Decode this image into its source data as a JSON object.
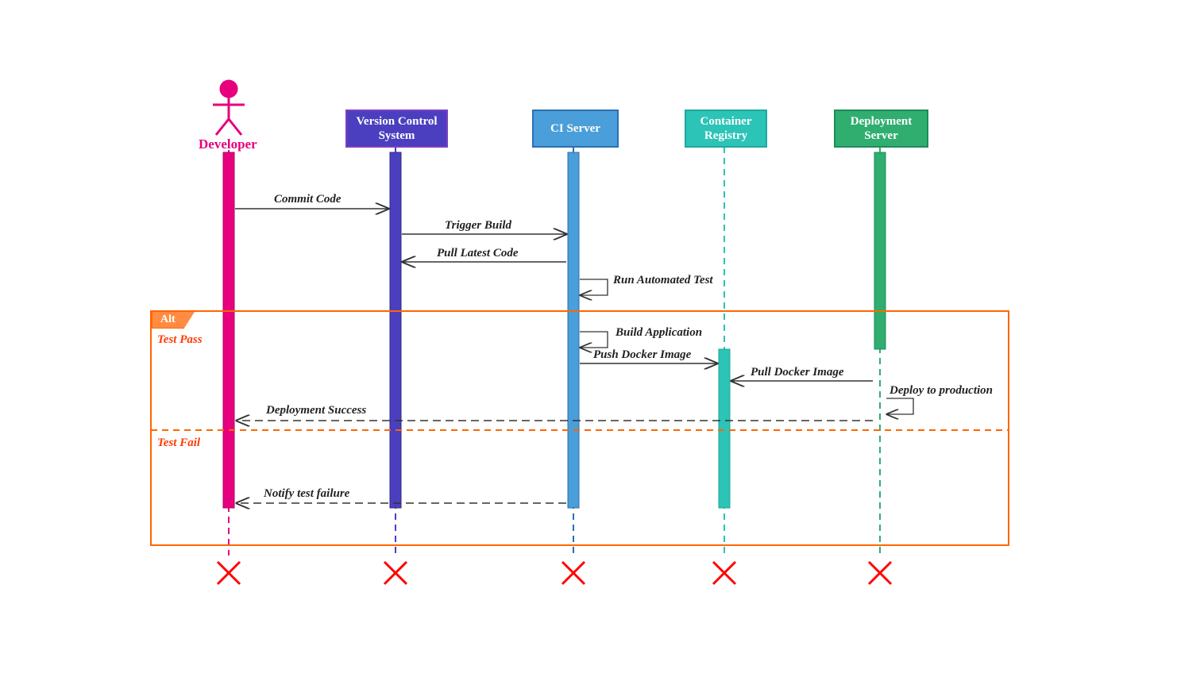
{
  "participants": {
    "developer": "Developer",
    "vcs": "Version Control System",
    "ci": "CI Server",
    "registry": "Container Registry",
    "deploy": "Deployment Server"
  },
  "messages": {
    "commit": "Commit Code",
    "trigger": "Trigger Build",
    "pull_code": "Pull Latest Code",
    "run_test": "Run Automated Test",
    "build_app": "Build Application",
    "push_image": "Push Docker Image",
    "pull_image": "Pull Docker Image",
    "deploy_prod": "Deploy to production",
    "deploy_success": "Deployment Success",
    "notify_fail": "Notify test failure"
  },
  "alt": {
    "tag": "Alt",
    "pass": "Test Pass",
    "fail": "Test Fail"
  },
  "colors": {
    "developer": "#e6007e",
    "vcs_fill": "#4b3fbf",
    "vcs_stroke": "#7d3fbf",
    "ci_fill": "#4a9ed9",
    "ci_stroke": "#2b6fb0",
    "registry_fill": "#2bc4b6",
    "registry_stroke": "#1fa89c",
    "deploy_fill": "#2fae6f",
    "deploy_stroke": "#1f8c56",
    "alt_border": "#ff6600",
    "destroy": "#ff0000"
  },
  "geometry": {
    "lifelines_x": {
      "dev": 288,
      "vcs": 498,
      "ci": 722,
      "reg": 912,
      "dep": 1108
    },
    "top_of_lifeline": 172,
    "bottom_of_lifeline": 720,
    "activation_width": 14
  },
  "chart_data": {
    "type": "sequence_diagram",
    "participants": [
      {
        "id": "dev",
        "name": "Developer",
        "kind": "actor"
      },
      {
        "id": "vcs",
        "name": "Version Control System",
        "kind": "object"
      },
      {
        "id": "ci",
        "name": "CI Server",
        "kind": "object"
      },
      {
        "id": "reg",
        "name": "Container Registry",
        "kind": "object"
      },
      {
        "id": "dep",
        "name": "Deployment Server",
        "kind": "object"
      }
    ],
    "messages": [
      {
        "from": "dev",
        "to": "vcs",
        "label": "Commit Code",
        "style": "solid"
      },
      {
        "from": "vcs",
        "to": "ci",
        "label": "Trigger Build",
        "style": "solid"
      },
      {
        "from": "ci",
        "to": "vcs",
        "label": "Pull Latest Code",
        "style": "solid"
      },
      {
        "from": "ci",
        "to": "ci",
        "label": "Run Automated Test",
        "style": "self"
      },
      {
        "fragment": "alt",
        "label": "Alt",
        "branches": [
          {
            "guard": "Test Pass",
            "messages": [
              {
                "from": "ci",
                "to": "ci",
                "label": "Build Application",
                "style": "self"
              },
              {
                "from": "ci",
                "to": "reg",
                "label": "Push Docker Image",
                "style": "solid"
              },
              {
                "from": "dep",
                "to": "reg",
                "label": "Pull Docker Image",
                "style": "solid"
              },
              {
                "from": "dep",
                "to": "dep",
                "label": "Deploy to production",
                "style": "self"
              },
              {
                "from": "dep",
                "to": "dev",
                "label": "Deployment Success",
                "style": "dashed"
              }
            ]
          },
          {
            "guard": "Test Fail",
            "messages": [
              {
                "from": "ci",
                "to": "dev",
                "label": "Notify test failure",
                "style": "dashed"
              }
            ]
          }
        ]
      }
    ],
    "destroy": [
      "dev",
      "vcs",
      "ci",
      "reg",
      "dep"
    ]
  }
}
